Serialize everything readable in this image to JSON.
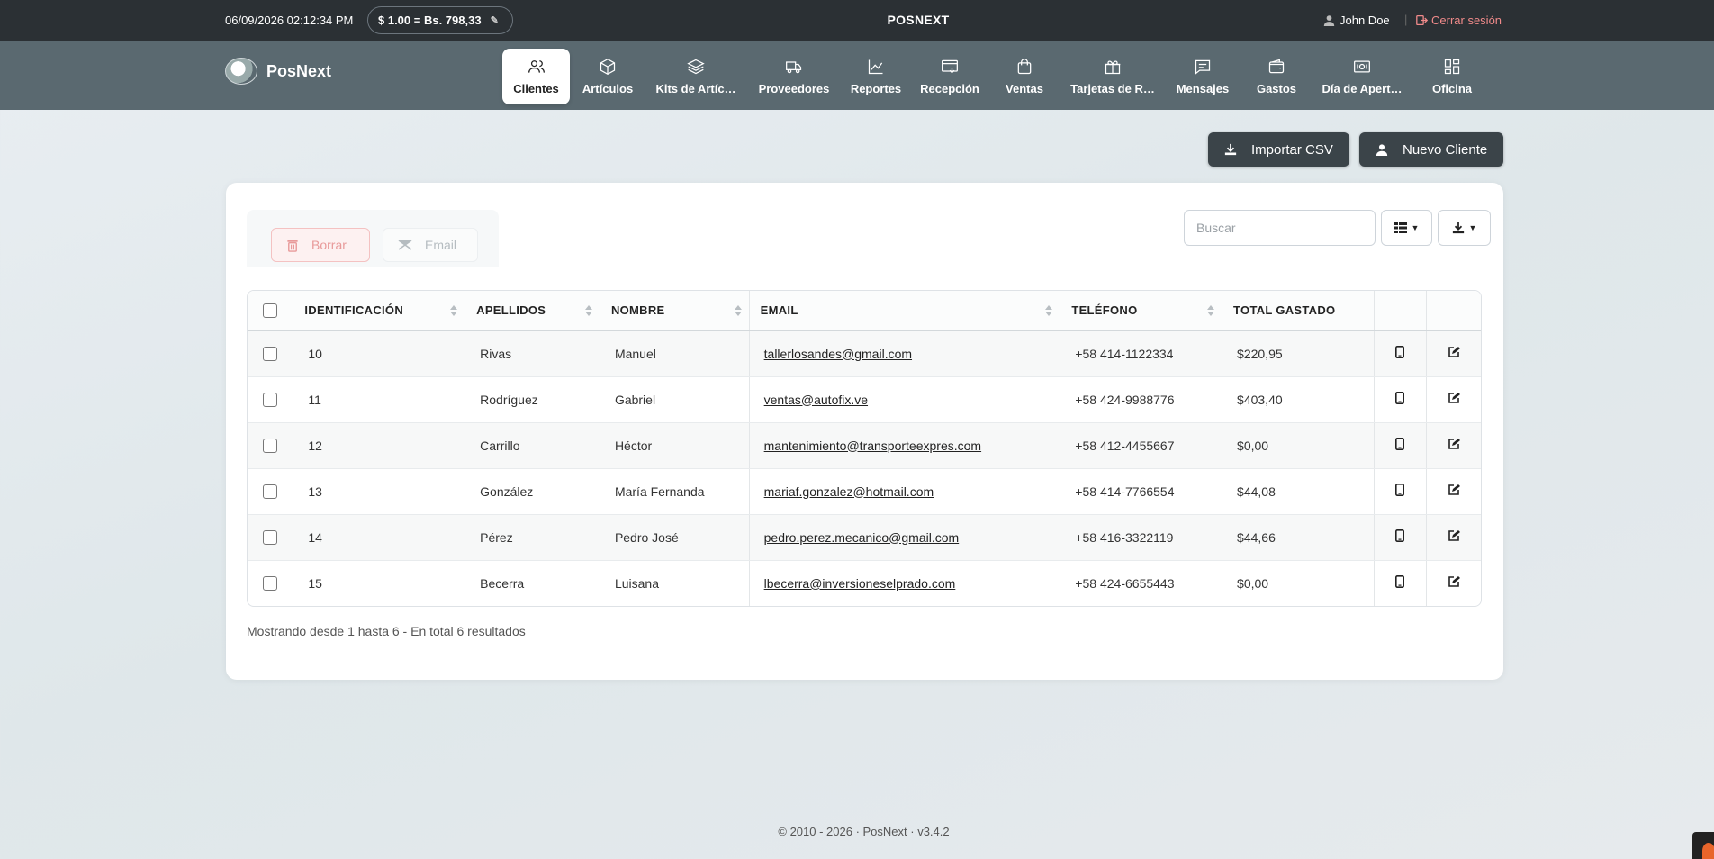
{
  "topbar": {
    "datetime": "06/09/2026 02:12:34 PM",
    "rate": "$  1.00 = Bs. 798,33",
    "app_title": "POSNEXT",
    "user": "John Doe",
    "logout": "Cerrar sesión"
  },
  "navbar": {
    "logo": "PosNext",
    "items": [
      {
        "label": "Clientes",
        "icon": "users-icon"
      },
      {
        "label": "Artículos",
        "icon": "box-icon"
      },
      {
        "label": "Kits de Artíc…",
        "icon": "layers-icon"
      },
      {
        "label": "Proveedores",
        "icon": "truck-icon"
      },
      {
        "label": "Reportes",
        "icon": "chart-icon"
      },
      {
        "label": "Recepción",
        "icon": "inbox-icon"
      },
      {
        "label": "Ventas",
        "icon": "shopping-bag-icon"
      },
      {
        "label": "Tarjetas de R…",
        "icon": "gift-icon"
      },
      {
        "label": "Mensajes",
        "icon": "message-icon"
      },
      {
        "label": "Gastos",
        "icon": "wallet-icon"
      },
      {
        "label": "Día de Apert…",
        "icon": "cash-icon"
      },
      {
        "label": "Oficina",
        "icon": "grid-icon"
      }
    ]
  },
  "actions": {
    "import_csv": "Importar CSV",
    "new_customer": "Nuevo Cliente"
  },
  "bulk": {
    "delete": "Borrar",
    "email": "Email"
  },
  "search": {
    "placeholder": "Buscar"
  },
  "table": {
    "headers": [
      "IDENTIFICACIÓN",
      "APELLIDOS",
      "NOMBRE",
      "EMAIL",
      "TELÉFONO",
      "TOTAL GASTADO"
    ],
    "rows": [
      {
        "id": "10",
        "last": "Rivas",
        "first": "Manuel",
        "email": "tallerlosandes@gmail.com",
        "phone": "+58 414-1122334",
        "total": "$220,95"
      },
      {
        "id": "11",
        "last": "Rodríguez",
        "first": "Gabriel",
        "email": "ventas@autofix.ve",
        "phone": "+58 424-9988776",
        "total": "$403,40"
      },
      {
        "id": "12",
        "last": "Carrillo",
        "first": "Héctor",
        "email": "mantenimiento@transporteexpres.com",
        "phone": "+58 412-4455667",
        "total": "$0,00"
      },
      {
        "id": "13",
        "last": "González",
        "first": "María Fernanda",
        "email": "mariaf.gonzalez@hotmail.com",
        "phone": "+58 414-7766554",
        "total": "$44,08"
      },
      {
        "id": "14",
        "last": "Pérez",
        "first": "Pedro José",
        "email": "pedro.perez.mecanico@gmail.com",
        "phone": "+58 416-3322119",
        "total": "$44,66"
      },
      {
        "id": "15",
        "last": "Becerra",
        "first": "Luisana",
        "email": "lbecerra@inversioneselprado.com",
        "phone": "+58 424-6655443",
        "total": "$0,00"
      }
    ]
  },
  "pagination_info": "Mostrando desde 1 hasta 6 - En total 6 resultados",
  "footer": "© 2010 - 2026 · PosNext · v3.4.2"
}
